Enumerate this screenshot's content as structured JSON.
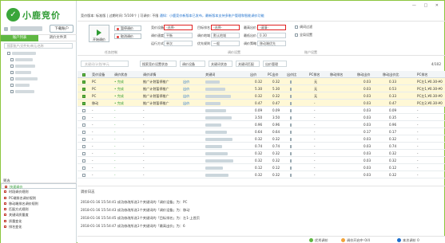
{
  "sidebar": {
    "logo_text": "小鹿竞价",
    "download_button": "下载账户",
    "tabs": [
      "账户列表",
      "调价文件夹"
    ],
    "search_placeholder": "搜索账户/文件夹/单元/名称",
    "tree_counts": [
      "",
      "",
      "",
      "",
      "",
      "",
      "",
      ""
    ],
    "lower_header": "筛选",
    "lower_items": [
      {
        "label": "快速调价",
        "selected": true
      },
      {
        "label": "时段调价规则",
        "selected": false
      },
      {
        "label": "PC端排名调价规则",
        "selected": false
      },
      {
        "label": "移动端排名调价规则",
        "selected": false
      },
      {
        "label": "匹配方式规则",
        "selected": false
      },
      {
        "label": "关键词质量度",
        "selected": false
      },
      {
        "label": "质量变化",
        "selected": false
      },
      {
        "label": "排名变化",
        "selected": false
      }
    ]
  },
  "topbar": {
    "info": "竞价版本: 标准版 | 过期时间: 5/100个 | 可调价: 不限",
    "link": "通知：小鹿竞价新版本已发布，最新版本支持多账户管理和智能调价功能"
  },
  "ribbon": {
    "start_button": "开始调价",
    "stop_button": "暂停调价",
    "stop_all_button": "取消调价",
    "group1_label": "任务控制",
    "fields": {
      "bid_device_label": "竞价设备",
      "bid_device_value": "-选择-",
      "adjust_speed_label": "调价速度",
      "adjust_speed_value": "平衡",
      "run_mode_label": "运行方式",
      "run_mode_value": "单次",
      "target_rank_label": "目标排名",
      "target_rank_value": "-选择-",
      "bid_region_label": "调价地域",
      "bid_region_value": "默认地域",
      "priority_label": "优先规则",
      "priority_value": "一般",
      "max_bid_label": "最高出价",
      "max_bid_value": "-请填-",
      "min_bid_label": "最低出价",
      "min_bid_value": "0.30",
      "adjust_strategy_label": "调价策略",
      "adjust_strategy_value": "移动端优先",
      "group2_label": "调价设置",
      "group3_label": "账户设置",
      "option1": "调词过滤",
      "option2": "全局设置"
    }
  },
  "filter": {
    "search_placeholder": "关键词/计划/单元",
    "select1": "搜索竞价设置状态",
    "select2": "调价设备",
    "select3": "关键词状态",
    "select4": "关键词匹配",
    "select5": "出价管理",
    "page_count": "4/102"
  },
  "table": {
    "headers": [
      "竞价设备",
      "调价状态",
      "调价详情",
      "关键词",
      "出价",
      "PC出价",
      "出价比",
      "PC排名",
      "移动排名",
      "移动出价",
      "移动出价比",
      "PC排名"
    ],
    "rows": [
      {
        "device": "PC",
        "status": "• 完成",
        "detail": "推广计划暂停推广",
        "action": "出价",
        "bid": "0.32",
        "pc_bid": "0.32",
        "rank": "无",
        "mob_bid": "0.03",
        "mob_ratio": "0.33",
        "last": "PC左1,¥0.30-¥0",
        "checked": true
      },
      {
        "device": "PC",
        "status": "• 完成",
        "detail": "推广计划暂停推广",
        "action": "出价",
        "bid": "5.30",
        "pc_bid": "5.30",
        "rank": "无",
        "mob_bid": "0.03",
        "mob_ratio": "0.53",
        "last": "PC左1,¥0.30-¥0",
        "checked": true
      },
      {
        "device": "PC",
        "status": "• 完成",
        "detail": "推广计划暂停推广",
        "action": "出价",
        "bid": "0.32",
        "pc_bid": "0.32",
        "rank": "无",
        "mob_bid": "0.03",
        "mob_ratio": "0.33",
        "last": "PC左1,¥0.30-¥0",
        "checked": true
      },
      {
        "device": "移动",
        "status": "• 完成",
        "detail": "推广计划暂停推广",
        "action": "出价",
        "bid": "0.47",
        "pc_bid": "0.47",
        "rank": "-",
        "mob_bid": "0.03",
        "mob_ratio": "0.47",
        "last": "PC左2,¥0.30-¥0",
        "checked": true
      },
      {
        "device": "-",
        "status": "-",
        "detail": "-",
        "action": "",
        "bid": "0.09",
        "pc_bid": "0.09",
        "rank": "-",
        "mob_bid": "0.03",
        "mob_ratio": "0.09",
        "last": "-",
        "checked": false
      },
      {
        "device": "-",
        "status": "-",
        "detail": "-",
        "action": "",
        "bid": "3.50",
        "pc_bid": "3.50",
        "rank": "-",
        "mob_bid": "0.03",
        "mob_ratio": "0.35",
        "last": "-",
        "checked": false
      },
      {
        "device": "-",
        "status": "-",
        "detail": "-",
        "action": "",
        "bid": "0.96",
        "pc_bid": "0.96",
        "rank": "-",
        "mob_bid": "0.03",
        "mob_ratio": "0.96",
        "last": "-",
        "checked": false
      },
      {
        "device": "-",
        "status": "-",
        "detail": "-",
        "action": "",
        "bid": "0.64",
        "pc_bid": "0.64",
        "rank": "-",
        "mob_bid": "0.17",
        "mob_ratio": "0.17",
        "last": "-",
        "checked": false
      },
      {
        "device": "-",
        "status": "-",
        "detail": "-",
        "action": "",
        "bid": "0.32",
        "pc_bid": "0.32",
        "rank": "-",
        "mob_bid": "0.03",
        "mob_ratio": "0.32",
        "last": "-",
        "checked": false
      },
      {
        "device": "-",
        "status": "-",
        "detail": "-",
        "action": "",
        "bid": "0.74",
        "pc_bid": "0.74",
        "rank": "-",
        "mob_bid": "0.03",
        "mob_ratio": "0.74",
        "last": "-",
        "checked": false
      },
      {
        "device": "-",
        "status": "-",
        "detail": "-",
        "action": "",
        "bid": "0.32",
        "pc_bid": "0.32",
        "rank": "-",
        "mob_bid": "0.03",
        "mob_ratio": "0.32",
        "last": "-",
        "checked": false
      },
      {
        "device": "-",
        "status": "-",
        "detail": "-",
        "action": "",
        "bid": "0.32",
        "pc_bid": "0.32",
        "rank": "-",
        "mob_bid": "0.03",
        "mob_ratio": "0.32",
        "last": "-",
        "checked": false
      },
      {
        "device": "-",
        "status": "-",
        "detail": "-",
        "action": "",
        "bid": "0.12",
        "pc_bid": "0.12",
        "rank": "-",
        "mob_bid": "0.03",
        "mob_ratio": "0.12",
        "last": "-",
        "checked": false
      },
      {
        "device": "-",
        "status": "-",
        "detail": "-",
        "action": "",
        "bid": "0.32",
        "pc_bid": "0.32",
        "rank": "-",
        "mob_bid": "0.03",
        "mob_ratio": "0.32",
        "last": "-",
        "checked": false
      }
    ]
  },
  "log": {
    "title": "调价日志",
    "lines": [
      "2018-01-16 15:54:41 成功修改所选1个关键词的「调价设备」为：PC",
      "2018-01-16 15:54:43 成功修改所选1个关键词的「调价设备」为：移动",
      "2018-01-16 15:54:45 成功修改所选1个关键词的「目标排名」为：左1-上首页",
      "2018-01-16 15:54:47 成功修改所选1个关键词的「最高出价」为：6"
    ]
  },
  "statusbar": {
    "items": [
      "优秀调价",
      "调价开启中 0/4",
      "本次调价 0"
    ]
  }
}
